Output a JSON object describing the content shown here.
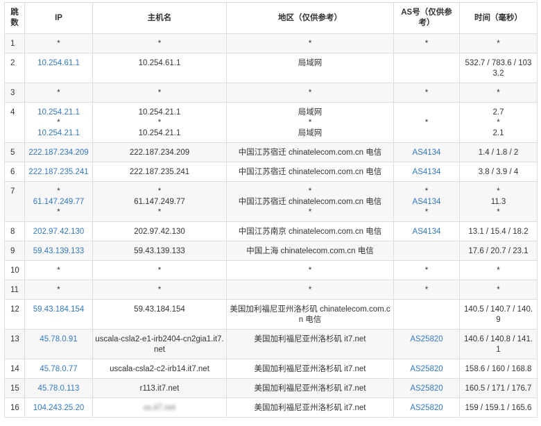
{
  "headers": {
    "hop": "跳数",
    "ip": "IP",
    "hostname": "主机名",
    "region": "地区（仅供参考）",
    "asn": "AS号（仅供参考）",
    "time": "时间（毫秒）"
  },
  "rows": [
    {
      "hop": "1",
      "ip": [
        "*"
      ],
      "host": [
        "*"
      ],
      "region": [
        "*"
      ],
      "asn": [
        "*"
      ],
      "time": [
        "*"
      ]
    },
    {
      "hop": "2",
      "ip": [
        "10.254.61.1"
      ],
      "host": [
        "10.254.61.1"
      ],
      "region": [
        "局域网"
      ],
      "asn": [
        ""
      ],
      "time": [
        "532.7 / 783.6 / 1033.2"
      ]
    },
    {
      "hop": "3",
      "ip": [
        "*"
      ],
      "host": [
        "*"
      ],
      "region": [
        "*"
      ],
      "asn": [
        "*"
      ],
      "time": [
        "*"
      ]
    },
    {
      "hop": "4",
      "ip": [
        "10.254.21.1",
        "*",
        "10.254.21.1"
      ],
      "host": [
        "10.254.21.1",
        "*",
        "10.254.21.1"
      ],
      "region": [
        "局域网",
        "*",
        "局域网"
      ],
      "asn": [
        "",
        "*",
        ""
      ],
      "time": [
        "2.7",
        "*",
        "2.1"
      ]
    },
    {
      "hop": "5",
      "ip": [
        "222.187.234.209"
      ],
      "host": [
        "222.187.234.209"
      ],
      "region": [
        "中国江苏宿迁 chinatelecom.com.cn 电信"
      ],
      "asn": [
        "AS4134"
      ],
      "time": [
        "1.4 / 1.8 / 2"
      ]
    },
    {
      "hop": "6",
      "ip": [
        "222.187.235.241"
      ],
      "host": [
        "222.187.235.241"
      ],
      "region": [
        "中国江苏宿迁 chinatelecom.com.cn 电信"
      ],
      "asn": [
        "AS4134"
      ],
      "time": [
        "3.8 / 3.9 / 4"
      ]
    },
    {
      "hop": "7",
      "ip": [
        "*",
        "61.147.249.77",
        "*"
      ],
      "host": [
        "*",
        "61.147.249.77",
        "*"
      ],
      "region": [
        "*",
        "中国江苏宿迁 chinatelecom.com.cn 电信",
        "*"
      ],
      "asn": [
        "*",
        "AS4134",
        "*"
      ],
      "time": [
        "*",
        "11.3",
        "*"
      ]
    },
    {
      "hop": "8",
      "ip": [
        "202.97.42.130"
      ],
      "host": [
        "202.97.42.130"
      ],
      "region": [
        "中国江苏南京 chinatelecom.com.cn 电信"
      ],
      "asn": [
        "AS4134"
      ],
      "time": [
        "13.1 / 15.4 / 18.2"
      ]
    },
    {
      "hop": "9",
      "ip": [
        "59.43.139.133"
      ],
      "host": [
        "59.43.139.133"
      ],
      "region": [
        "中国上海 chinatelecom.com.cn 电信"
      ],
      "asn": [
        ""
      ],
      "time": [
        "17.6 / 20.7 / 23.1"
      ]
    },
    {
      "hop": "10",
      "ip": [
        "*"
      ],
      "host": [
        "*"
      ],
      "region": [
        "*"
      ],
      "asn": [
        "*"
      ],
      "time": [
        "*"
      ]
    },
    {
      "hop": "11",
      "ip": [
        "*"
      ],
      "host": [
        "*"
      ],
      "region": [
        "*"
      ],
      "asn": [
        "*"
      ],
      "time": [
        "*"
      ]
    },
    {
      "hop": "12",
      "ip": [
        "59.43.184.154"
      ],
      "host": [
        "59.43.184.154"
      ],
      "region": [
        "美国加利福尼亚州洛杉矶 chinatelecom.com.cn 电信"
      ],
      "asn": [
        ""
      ],
      "time": [
        "140.5 / 140.7 / 140.9"
      ]
    },
    {
      "hop": "13",
      "ip": [
        "45.78.0.91"
      ],
      "host": [
        "uscala-csla2-e1-irb2404-cn2gia1.it7.net"
      ],
      "region": [
        "美国加利福尼亚州洛杉矶 it7.net"
      ],
      "asn": [
        "AS25820"
      ],
      "time": [
        "140.6 / 140.8 / 141.1"
      ]
    },
    {
      "hop": "14",
      "ip": [
        "45.78.0.77"
      ],
      "host": [
        "uscala-csla2-c2-irb14.it7.net"
      ],
      "region": [
        "美国加利福尼亚州洛杉矶 it7.net"
      ],
      "asn": [
        "AS25820"
      ],
      "time": [
        "158.6 / 160 / 168.8"
      ]
    },
    {
      "hop": "15",
      "ip": [
        "45.78.0.113"
      ],
      "host": [
        "r113.it7.net"
      ],
      "region": [
        "美国加利福尼亚州洛杉矶 it7.net"
      ],
      "asn": [
        "AS25820"
      ],
      "time": [
        "160.5 / 171 / 176.7"
      ]
    },
    {
      "hop": "16",
      "ip": [
        "104.243.25.20"
      ],
      "host": [
        "xx.it7.net"
      ],
      "region": [
        "美国加利福尼亚州洛杉矶 it7.net"
      ],
      "asn": [
        "AS25820"
      ],
      "time": [
        "159 / 159.1 / 165.6"
      ]
    }
  ],
  "styles": {
    "link_color": "#3178c6",
    "text_color": "#333333",
    "border_color": "#dddddd",
    "stripe_color": "#f7f7f7"
  }
}
